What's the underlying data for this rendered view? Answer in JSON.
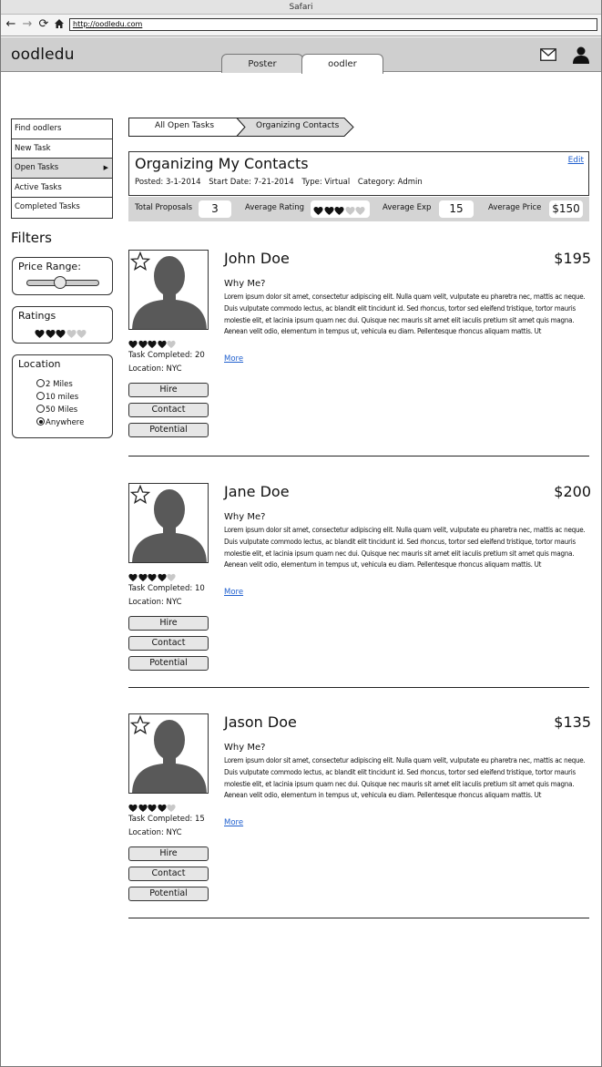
{
  "browser": {
    "window_title": "Safari",
    "url": "http://oodledu.com"
  },
  "header": {
    "logo": "oodledu",
    "tabs": [
      {
        "label": "Poster"
      },
      {
        "label": "oodler"
      }
    ],
    "icons": [
      "mail-icon",
      "user-icon"
    ]
  },
  "sidebar": {
    "items": [
      {
        "label": "Find oodlers"
      },
      {
        "label": "New Task"
      },
      {
        "label": "Open Tasks",
        "active": true,
        "arrow": "▶"
      },
      {
        "label": "Active Tasks"
      },
      {
        "label": "Completed Tasks"
      }
    ]
  },
  "filters": {
    "title": "Filters",
    "price_range": {
      "label": "Price Range:",
      "slider_value": 0.45
    },
    "ratings": {
      "label": "Ratings",
      "value": 3,
      "max": 5
    },
    "location": {
      "label": "Location",
      "options": [
        {
          "label": "2 Miles",
          "selected": false
        },
        {
          "label": "10 miles",
          "selected": false
        },
        {
          "label": "50 Miles",
          "selected": false
        },
        {
          "label": "Anywhere",
          "selected": true
        }
      ]
    }
  },
  "breadcrumb": [
    "All Open Tasks",
    "Organizing Contacts"
  ],
  "task": {
    "title": "Organizing My Contacts",
    "edit_label": "Edit",
    "posted": "Posted: 3-1-2014",
    "start_date": "Start Date: 7-21-2014",
    "type": "Type: Virtual",
    "category": "Category: Admin"
  },
  "stats": {
    "total_proposals_label": "Total Proposals",
    "total_proposals": "3",
    "average_rating_label": "Average Rating",
    "average_rating": 3,
    "average_exp_label": "Average Exp",
    "average_exp": "15",
    "average_price_label": "Average Price",
    "average_price": "$150"
  },
  "candidates": [
    {
      "name": "John Doe",
      "price": "$195",
      "rating": 4,
      "tasks_completed": "Task Completed: 20",
      "location": "Location: NYC",
      "why_label": "Why Me?",
      "bio": "Lorem ipsum dolor sit amet, consectetur adipiscing elit. Nulla quam velit, vulputate eu pharetra nec, mattis ac neque. Duis vulputate commodo lectus, ac blandit elit tincidunt id. Sed rhoncus, tortor sed eleifend tristique, tortor mauris molestie elit, et lacinia ipsum quam nec dui. Quisque nec mauris sit amet elit iaculis pretium sit amet quis magna. Aenean velit odio, elementum in tempus ut, vehicula eu diam. Pellentesque rhoncus aliquam mattis. Ut",
      "more_label": "More",
      "buttons": [
        "Hire",
        "Contact",
        "Potential"
      ]
    },
    {
      "name": "Jane Doe",
      "price": "$200",
      "rating": 4,
      "tasks_completed": "Task Completed: 10",
      "location": "Location: NYC",
      "why_label": "Why Me?",
      "bio": "Lorem ipsum dolor sit amet, consectetur adipiscing elit. Nulla quam velit, vulputate eu pharetra nec, mattis ac neque. Duis vulputate commodo lectus, ac blandit elit tincidunt id. Sed rhoncus, tortor sed eleifend tristique, tortor mauris molestie elit, et lacinia ipsum quam nec dui. Quisque nec mauris sit amet elit iaculis pretium sit amet quis magna. Aenean velit odio, elementum in tempus ut, vehicula eu diam. Pellentesque rhoncus aliquam mattis. Ut",
      "more_label": "More",
      "buttons": [
        "Hire",
        "Contact",
        "Potential"
      ]
    },
    {
      "name": "Jason Doe",
      "price": "$135",
      "rating": 4,
      "tasks_completed": "Task Completed: 15",
      "location": "Location: NYC",
      "why_label": "Why Me?",
      "bio": "Lorem ipsum dolor sit amet, consectetur adipiscing elit. Nulla quam velit, vulputate eu pharetra nec, mattis ac neque. Duis vulputate commodo lectus, ac blandit elit tincidunt id. Sed rhoncus, tortor sed eleifend tristique, tortor mauris molestie elit, et lacinia ipsum quam nec dui. Quisque nec mauris sit amet elit iaculis pretium sit amet quis magna. Aenean velit odio, elementum in tempus ut, vehicula eu diam. Pellentesque rhoncus aliquam mattis. Ut",
      "more_label": "More",
      "buttons": [
        "Hire",
        "Contact",
        "Potential"
      ]
    }
  ],
  "colors": {
    "header_bg": "#cfcfcf",
    "link": "#1f5fce",
    "heart_filled": "#111111",
    "heart_empty": "#c8c8c8",
    "silhouette": "#595959"
  }
}
